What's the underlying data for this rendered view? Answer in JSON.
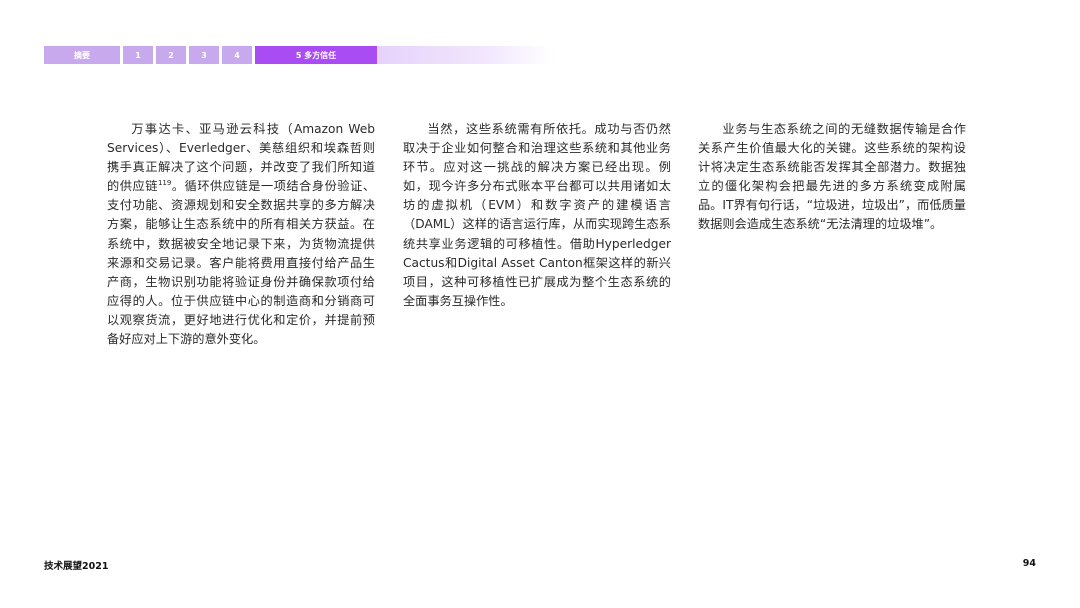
{
  "nav": {
    "summary_label": "摘要",
    "tabs": [
      "1",
      "2",
      "3",
      "4"
    ],
    "active_label": "5 多方信任"
  },
  "columns": {
    "col1": {
      "text_a": "万事达卡、亚马逊云科技（Amazon Web Services）、Everledger、美慈组织和埃森哲则携手真正解决了这个问题，并改变了我们所知道的供应链",
      "footnote": "119",
      "text_b": "。循环供应链是一项结合身份验证、支付功能、资源规划和安全数据共享的多方解决方案，能够让生态系统中的所有相关方获益。在系统中，数据被安全地记录下来，为货物流提供来源和交易记录。客户能将费用直接付给产品生产商，生物识别功能将验证身份并确保款项付给应得的人。位于供应链中心的制造商和分销商可以观察货流，更好地进行优化和定价，并提前预备好应对上下游的意外变化。"
    },
    "col2": {
      "text": "当然，这些系统需有所依托。成功与否仍然取决于企业如何整合和治理这些系统和其他业务环节。应对这一挑战的解决方案已经出现。例如，现今许多分布式账本平台都可以共用诸如太坊的虚拟机（EVM）和数字资产的建模语言（DAML）这样的语言运行库，从而实现跨生态系统共享业务逻辑的可移植性。借助Hyperledger Cactus和Digital Asset Canton框架这样的新兴项目，这种可移植性已扩展成为整个生态系统的全面事务互操作性。"
    },
    "col3": {
      "text": "业务与生态系统之间的无缝数据传输是合作关系产生价值最大化的关键。这些系统的架构设计将决定生态系统能否发挥其全部潜力。数据独立的僵化架构会把最先进的多方系统变成附属品。IT界有句行话，“垃圾进，垃圾出”，而低质量数据则会造成生态系统“无法清理的垃圾堆”。"
    }
  },
  "footer": {
    "title": "技术展望2021",
    "page_number": "94"
  },
  "colors": {
    "tab_light": "#c9a9ee",
    "tab_active": "#a94cf3"
  }
}
